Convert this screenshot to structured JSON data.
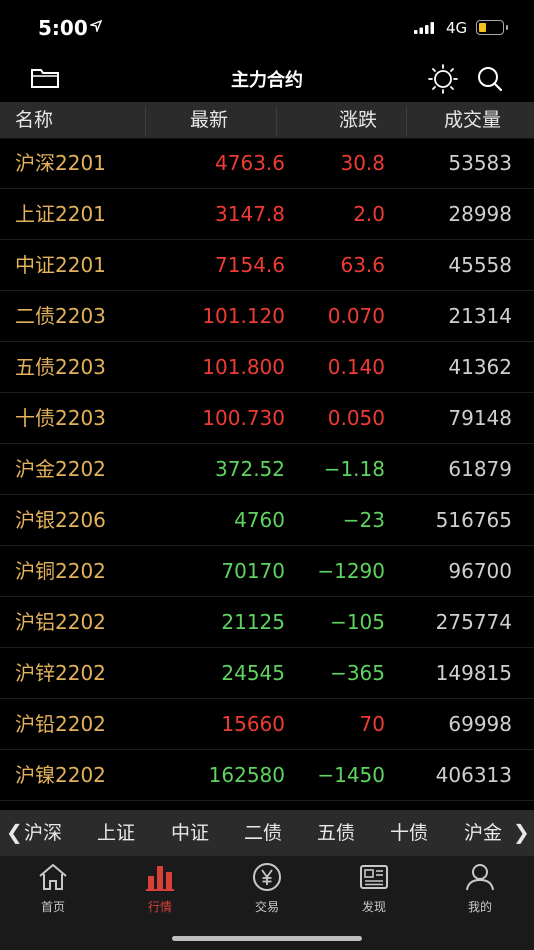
{
  "status": {
    "time": "5:00",
    "network": "4G"
  },
  "nav": {
    "title": "主力合约"
  },
  "columns": {
    "name": "名称",
    "last": "最新",
    "change": "涨跌",
    "volume": "成交量"
  },
  "rows": [
    {
      "name": "沪深2201",
      "last": "4763.6",
      "change": "30.8",
      "volume": "53583",
      "dir": "up"
    },
    {
      "name": "上证2201",
      "last": "3147.8",
      "change": "2.0",
      "volume": "28998",
      "dir": "up"
    },
    {
      "name": "中证2201",
      "last": "7154.6",
      "change": "63.6",
      "volume": "45558",
      "dir": "up"
    },
    {
      "name": "二债2203",
      "last": "101.120",
      "change": "0.070",
      "volume": "21314",
      "dir": "up"
    },
    {
      "name": "五债2203",
      "last": "101.800",
      "change": "0.140",
      "volume": "41362",
      "dir": "up"
    },
    {
      "name": "十债2203",
      "last": "100.730",
      "change": "0.050",
      "volume": "79148",
      "dir": "up"
    },
    {
      "name": "沪金2202",
      "last": "372.52",
      "change": "−1.18",
      "volume": "61879",
      "dir": "down"
    },
    {
      "name": "沪银2206",
      "last": "4760",
      "change": "−23",
      "volume": "516765",
      "dir": "down"
    },
    {
      "name": "沪铜2202",
      "last": "70170",
      "change": "−1290",
      "volume": "96700",
      "dir": "down"
    },
    {
      "name": "沪铝2202",
      "last": "21125",
      "change": "−105",
      "volume": "275774",
      "dir": "down"
    },
    {
      "name": "沪锌2202",
      "last": "24545",
      "change": "−365",
      "volume": "149815",
      "dir": "down"
    },
    {
      "name": "沪铅2202",
      "last": "15660",
      "change": "70",
      "volume": "69998",
      "dir": "up"
    },
    {
      "name": "沪镍2202",
      "last": "162580",
      "change": "−1450",
      "volume": "406313",
      "dir": "down"
    }
  ],
  "categories": {
    "left_arrow": "❮",
    "right_arrow": "❯",
    "items": [
      "沪深",
      "上证",
      "中证",
      "二债",
      "五债",
      "十债",
      "沪金"
    ]
  },
  "tabs": [
    {
      "label": "首页",
      "icon": "home-icon"
    },
    {
      "label": "行情",
      "icon": "bar-chart-icon"
    },
    {
      "label": "交易",
      "icon": "yen-icon"
    },
    {
      "label": "发现",
      "icon": "news-icon"
    },
    {
      "label": "我的",
      "icon": "user-icon"
    }
  ],
  "colors": {
    "up": "#ee3b33",
    "down": "#5fd35f",
    "name": "#e3b25a",
    "active_tab": "#d9403a"
  }
}
